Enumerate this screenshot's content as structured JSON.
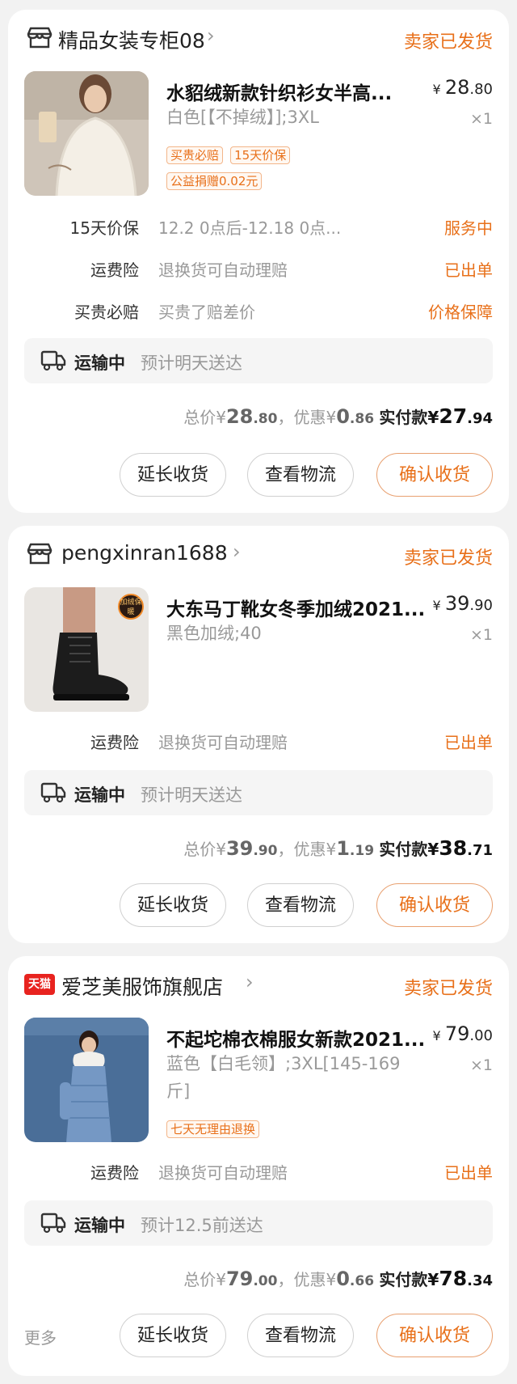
{
  "orders": [
    {
      "shop_name": "精品女装专柜08",
      "status": "卖家已发货",
      "item": {
        "title": "水貂绒新款针织衫女半高...",
        "spec": "白色[【不掉绒】];3XL",
        "price_int": "28",
        "price_dec": ".80",
        "qty": "×1",
        "tags": [
          "买贵必赔",
          "15天价保",
          "公益捐赠0.02元"
        ]
      },
      "services": [
        {
          "label": "15天价保",
          "desc": "12.2 0点后-12.18 0点...",
          "status": "服务中"
        },
        {
          "label": "运费险",
          "desc": "退换货可自动理赔",
          "status": "已出单"
        },
        {
          "label": "买贵必赔",
          "desc": "买贵了赔差价",
          "status": "价格保障"
        }
      ],
      "shipping": {
        "status": "运输中",
        "eta": "预计明天送达"
      },
      "totals": {
        "total_label": "总价",
        "total_int": "28",
        "total_dec": ".80",
        "discount_label": "，优惠",
        "discount_int": "0",
        "discount_dec": ".86",
        "paid_label": "实付款",
        "paid_int": "27",
        "paid_dec": ".94"
      },
      "buttons": [
        "延长收货",
        "查看物流",
        "确认收货"
      ]
    },
    {
      "shop_name": "pengxinran1688",
      "status": "卖家已发货",
      "item": {
        "title": "大东马丁靴女冬季加绒2021...",
        "spec": "黑色加绒;40",
        "price_int": "39",
        "price_dec": ".90",
        "qty": "×1",
        "badge": "加绒保暖"
      },
      "services": [
        {
          "label": "运费险",
          "desc": "退换货可自动理赔",
          "status": "已出单"
        }
      ],
      "shipping": {
        "status": "运输中",
        "eta": "预计明天送达"
      },
      "totals": {
        "total_label": "总价",
        "total_int": "39",
        "total_dec": ".90",
        "discount_label": "，优惠",
        "discount_int": "1",
        "discount_dec": ".19",
        "paid_label": "实付款",
        "paid_int": "38",
        "paid_dec": ".71"
      },
      "buttons": [
        "延长收货",
        "查看物流",
        "确认收货"
      ]
    },
    {
      "shop_name": "爱芝美服饰旗舰店",
      "shop_badge": "天猫",
      "status": "卖家已发货",
      "item": {
        "title": "不起坨棉衣棉服女新款2021...",
        "spec": "蓝色【白毛领】;3XL[145-169斤]",
        "price_int": "79",
        "price_dec": ".00",
        "qty": "×1",
        "tags": [
          "七天无理由退换"
        ]
      },
      "services": [
        {
          "label": "运费险",
          "desc": "退换货可自动理赔",
          "status": "已出单"
        }
      ],
      "shipping": {
        "status": "运输中",
        "eta": "预计12.5前送达"
      },
      "totals": {
        "total_label": "总价",
        "total_int": "79",
        "total_dec": ".00",
        "discount_label": "，优惠",
        "discount_int": "0",
        "discount_dec": ".66",
        "paid_label": "实付款",
        "paid_int": "78",
        "paid_dec": ".34"
      },
      "more_label": "更多",
      "buttons": [
        "延长收货",
        "查看物流",
        "确认收货"
      ]
    }
  ],
  "currency_symbol": "¥",
  "colors": {
    "accent": "#e8701a",
    "background": "#f2f2f2",
    "tmall_red": "#e8231f"
  }
}
